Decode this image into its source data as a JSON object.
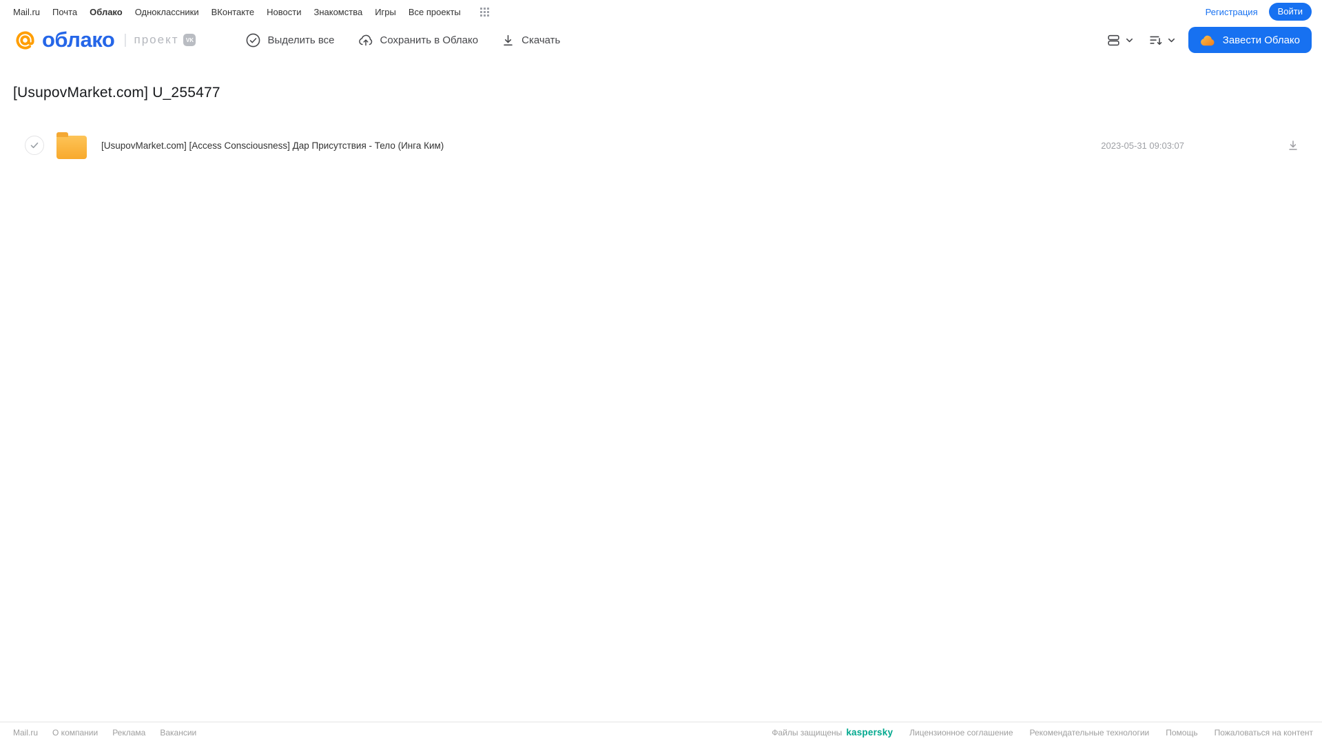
{
  "top_nav": {
    "items": [
      "Mail.ru",
      "Почта",
      "Облако",
      "Одноклассники",
      "ВКонтакте",
      "Новости",
      "Знакомства",
      "Игры",
      "Все проекты"
    ],
    "registration_label": "Регистрация",
    "login_label": "Войти"
  },
  "toolbar": {
    "logo_text": "облако",
    "project_label": "проект",
    "vk_badge_label": "VK",
    "select_all_label": "Выделить все",
    "save_to_cloud_label": "Сохранить в Облако",
    "download_label": "Скачать",
    "get_cloud_label": "Завести Облако"
  },
  "main": {
    "title": "[UsupovMarket.com] U_255477",
    "files": [
      {
        "type": "folder",
        "name": "[UsupovMarket.com] [Access Consciousness] Дар Присутствия - Тело (Инга Ким)",
        "date": "2023-05-31 09:03:07"
      }
    ]
  },
  "footer": {
    "left_links": [
      "Mail.ru",
      "О компании",
      "Реклама",
      "Вакансии"
    ],
    "protected_label": "Файлы защищены",
    "kaspersky_label": "kaspersky",
    "right_links": [
      "Лицензионное соглашение",
      "Рекомендательные технологии",
      "Помощь",
      "Пожаловаться на контент"
    ]
  },
  "colors": {
    "accent_blue": "#1771f1",
    "logo_blue": "#2566e8",
    "logo_orange": "#ff9e00",
    "folder_yellow": "#f9b233",
    "kaspersky_teal": "#00a88e",
    "text_dark": "#333333",
    "text_gray": "#9e9e9e"
  }
}
